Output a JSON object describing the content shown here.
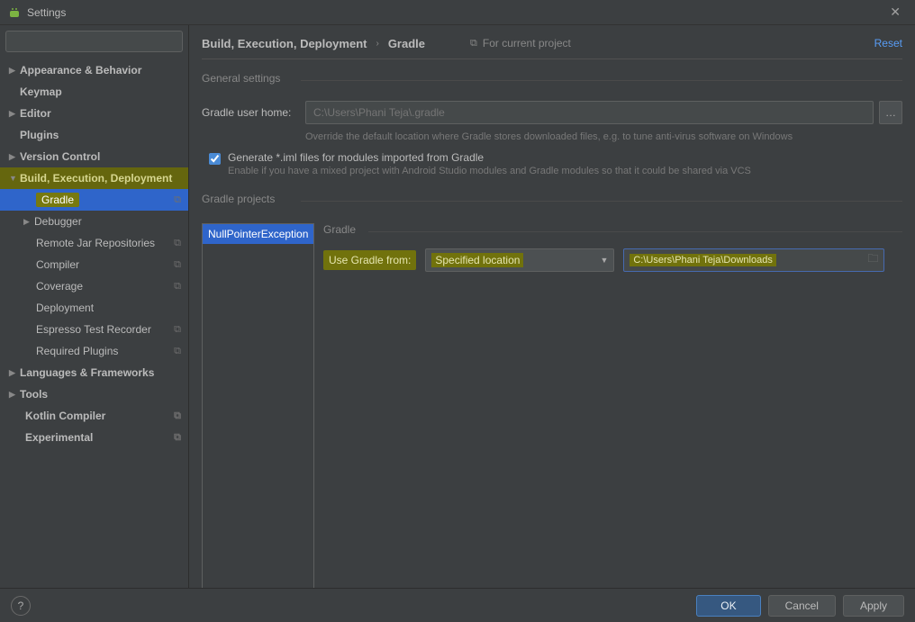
{
  "window": {
    "title": "Settings"
  },
  "search": {
    "placeholder": ""
  },
  "sidebar": {
    "items": [
      {
        "label": "Appearance & Behavior",
        "arrow": "▶"
      },
      {
        "label": "Keymap"
      },
      {
        "label": "Editor",
        "arrow": "▶"
      },
      {
        "label": "Plugins"
      },
      {
        "label": "Version Control",
        "arrow": "▶"
      },
      {
        "label": "Build, Execution, Deployment",
        "arrow": "▼",
        "highlight": true
      },
      {
        "label": "Gradle",
        "sub": true,
        "selected": true
      },
      {
        "label": "Debugger",
        "sub": true,
        "arrow": "▶"
      },
      {
        "label": "Remote Jar Repositories",
        "sub": true,
        "rowicon": true
      },
      {
        "label": "Compiler",
        "sub": true,
        "rowicon": true
      },
      {
        "label": "Coverage",
        "sub": true,
        "rowicon": true
      },
      {
        "label": "Deployment",
        "sub": true
      },
      {
        "label": "Espresso Test Recorder",
        "sub": true,
        "rowicon": true
      },
      {
        "label": "Required Plugins",
        "sub": true,
        "rowicon": true
      },
      {
        "label": "Languages & Frameworks",
        "arrow": "▶"
      },
      {
        "label": "Tools",
        "arrow": "▶"
      },
      {
        "label": "Kotlin Compiler",
        "sub0": true,
        "rowicon": true
      },
      {
        "label": "Experimental",
        "sub0": true,
        "rowicon": true
      }
    ]
  },
  "breadcrumb": {
    "a": "Build, Execution, Deployment",
    "b": "Gradle",
    "hint": "For current project",
    "reset": "Reset"
  },
  "general": {
    "section": "General settings",
    "user_home_label": "Gradle user home:",
    "user_home_value": "C:\\Users\\Phani Teja\\.gradle",
    "user_home_help": "Override the default location where Gradle stores downloaded files, e.g. to tune anti-virus software on Windows",
    "iml_label": "Generate *.iml files for modules imported from Gradle",
    "iml_help": "Enable if you have a mixed project with Android Studio modules and Gradle modules so that it could be shared via VCS"
  },
  "projects": {
    "section": "Gradle projects",
    "list": [
      "NullPointerException"
    ],
    "detail": {
      "section": "Gradle",
      "use_label": "Use Gradle from:",
      "dropdown": "Specified location",
      "path": "C:\\Users\\Phani Teja\\Downloads"
    }
  },
  "buttons": {
    "ok": "OK",
    "cancel": "Cancel",
    "apply": "Apply"
  }
}
